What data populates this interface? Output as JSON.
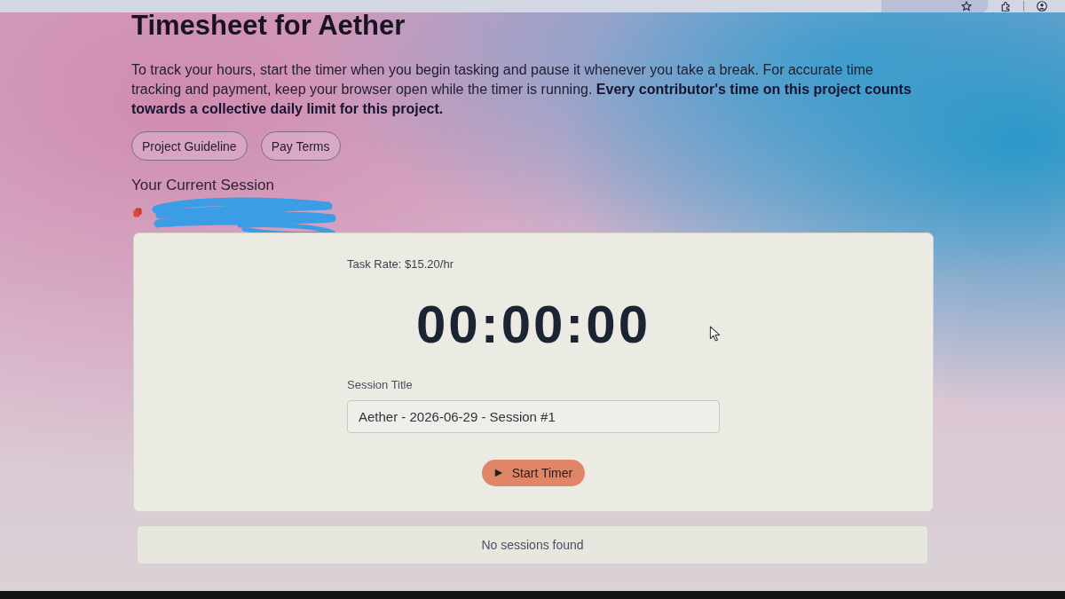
{
  "page": {
    "title": "Timesheet for Aether",
    "intro": "To track your hours, start the timer when you begin tasking and pause it whenever you take a break. For accurate time tracking and payment, keep your browser open while the timer is running. **Every contributor's time on this project counts towards a collective daily limit for this project.**",
    "links": [
      {
        "label": "Project Guideline"
      },
      {
        "label": "Pay Terms"
      }
    ]
  },
  "session": {
    "heading": "Your Current Session",
    "task_rate": "Task Rate: $15.20/hr",
    "timer": "00:00:00",
    "title_field": {
      "label": "Session Title",
      "value": "Aether - 2026-06-29 - Session #1"
    },
    "start_button": {
      "label": "Start Timer"
    }
  },
  "sessions_list": {
    "empty_message": "No sessions found"
  }
}
